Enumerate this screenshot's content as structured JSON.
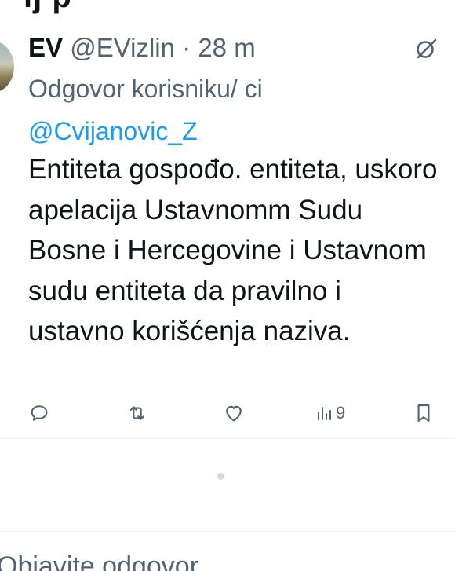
{
  "top_cut_text": "ij     p",
  "tweet": {
    "display_name": "EV",
    "handle": "@EVizlin",
    "separator": "·",
    "time": "28 m",
    "reply_prefix": "Odgovor korisniku/ ci",
    "reply_mention": "@Cvijanovic_Z",
    "text": "Entiteta gospođo. entiteta, uskoro apelacija Ustavnomm Sudu Bosne i Hercegovine i Ustavnom sudu entiteta da pravilno i ustavno korišćenja naziva.",
    "views": "9"
  },
  "icons": {
    "grok": "grok-icon",
    "reply": "reply-icon",
    "retweet": "retweet-icon",
    "like": "heart-icon",
    "views": "views-icon",
    "bookmark": "bookmark-icon"
  },
  "colors": {
    "text": "#0f1419",
    "secondary": "#536471",
    "link": "#1d9bf0"
  },
  "reply_prompt": "Objavite odgovor"
}
